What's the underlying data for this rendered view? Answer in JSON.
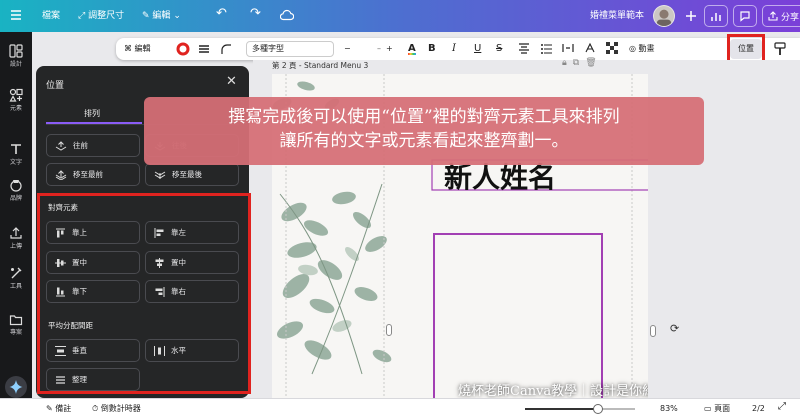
{
  "topbar": {
    "file": "檔案",
    "resize": "調整尺寸",
    "edit": "編輯",
    "project_title": "婚禮菜單範本",
    "share": "分享"
  },
  "toolbar": {
    "edit": "編輯",
    "font": "多種字型",
    "font_size": "–",
    "animate": "動畫",
    "position": "位置"
  },
  "sidebar": {
    "items": [
      {
        "label": "設計",
        "icon": "design-icon"
      },
      {
        "label": "元素",
        "icon": "elements-icon"
      },
      {
        "label": "文字",
        "icon": "text-icon"
      },
      {
        "label": "品牌",
        "icon": "brand-icon"
      },
      {
        "label": "上傳",
        "icon": "upload-icon"
      },
      {
        "label": "工具",
        "icon": "tools-icon"
      },
      {
        "label": "專案",
        "icon": "projects-icon"
      }
    ]
  },
  "panel": {
    "title": "位置",
    "tab_arrange": "排列",
    "layer_buttons": [
      "往前",
      "往後",
      "移至最前",
      "移至最後"
    ],
    "align_title": "對齊元素",
    "align_buttons": [
      "靠上",
      "靠左",
      "置中",
      "置中",
      "靠下",
      "靠右"
    ],
    "distribute_title": "平均分配間距",
    "distribute_buttons": [
      "垂直",
      "水平"
    ],
    "tidy": "整理"
  },
  "canvas": {
    "page_label": "第 2 頁 - Standard Menu 3",
    "name_text": "新人姓名"
  },
  "banner": {
    "line1": "撰寫完成後可以使用“位置”裡的對齊元素工具來排列",
    "line2": "讓所有的文字或元素看起來整齊劃一。"
  },
  "watermark": "燒杯老師Canva教學｜設計是你給世界的名片",
  "bottombar": {
    "notes": "備註",
    "timer": "倒數計時器",
    "zoom": "83%",
    "pages_label": "頁面",
    "page_count": "2/2",
    "zoom_fraction": 0.66
  },
  "colors": {
    "highlight": "#e0231f",
    "selection": "#a23fb3",
    "banner": "#d66e76"
  }
}
